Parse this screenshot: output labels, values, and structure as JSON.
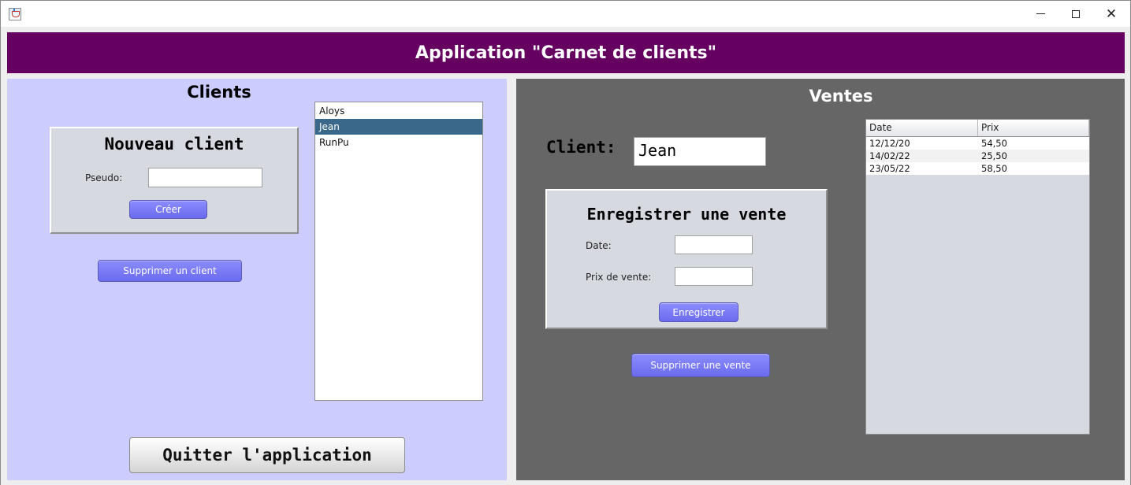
{
  "window": {
    "controls": {
      "minimize": "",
      "maximize": "",
      "close": "✕"
    }
  },
  "header": {
    "title": "Application \"Carnet de clients\""
  },
  "clients": {
    "title": "Clients",
    "new_client": {
      "title": "Nouveau client",
      "pseudo_label": "Pseudo:",
      "pseudo_value": "",
      "create_label": "Créer"
    },
    "delete_label": "Supprimer un client",
    "list": [
      "Aloys",
      "Jean",
      "RunPu"
    ],
    "selected": "Jean",
    "quit_label": "Quitter l'application"
  },
  "ventes": {
    "title": "Ventes",
    "client_label": "Client:",
    "client_value": "Jean",
    "register": {
      "title": "Enregistrer une vente",
      "date_label": "Date:",
      "date_value": "",
      "price_label": "Prix de vente:",
      "price_value": "",
      "save_label": "Enregistrer"
    },
    "delete_label": "Supprimer une vente",
    "table": {
      "columns": [
        "Date",
        "Prix"
      ],
      "rows": [
        [
          "12/12/20",
          "54,50"
        ],
        [
          "14/02/22",
          "25,50"
        ],
        [
          "23/05/22",
          "58,50"
        ]
      ]
    }
  },
  "colors": {
    "header_bg": "#650061",
    "clients_bg": "#ccccff",
    "ventes_bg": "#666666",
    "button_bg": "#7b7bf7",
    "selection_bg": "#39688a"
  }
}
